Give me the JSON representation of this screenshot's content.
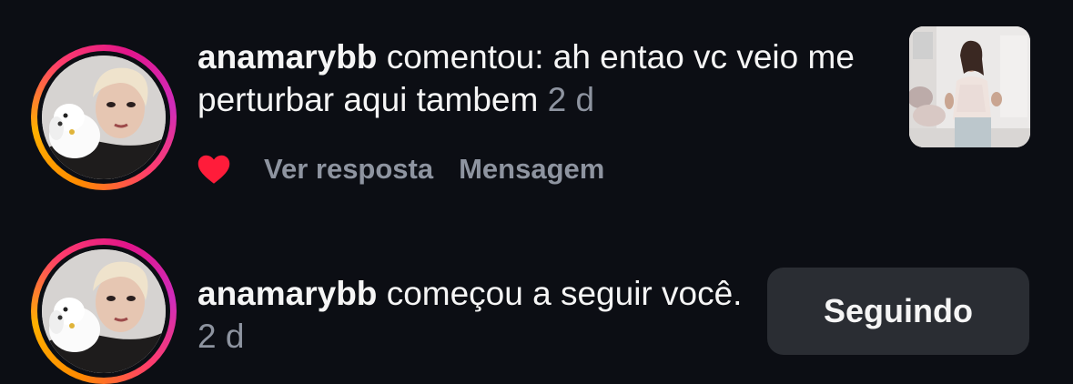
{
  "notifications": [
    {
      "username": "anamarybb",
      "message": "comentou: ah entao vc veio me perturbar aqui tambem",
      "time": "2 d",
      "liked": true,
      "actions": {
        "reply": "Ver resposta",
        "message": "Mensagem"
      },
      "has_post_thumbnail": true
    },
    {
      "username": "anamarybb",
      "message": "começou a seguir você.",
      "time": "2 d",
      "button_label": "Seguindo"
    }
  ],
  "colors": {
    "background": "#0c0e14",
    "text": "#f5f5f5",
    "muted": "#8e94a0",
    "heart": "#ff1c3a",
    "button_bg": "#2a2d33"
  },
  "icons": {
    "like": "heart-icon"
  }
}
